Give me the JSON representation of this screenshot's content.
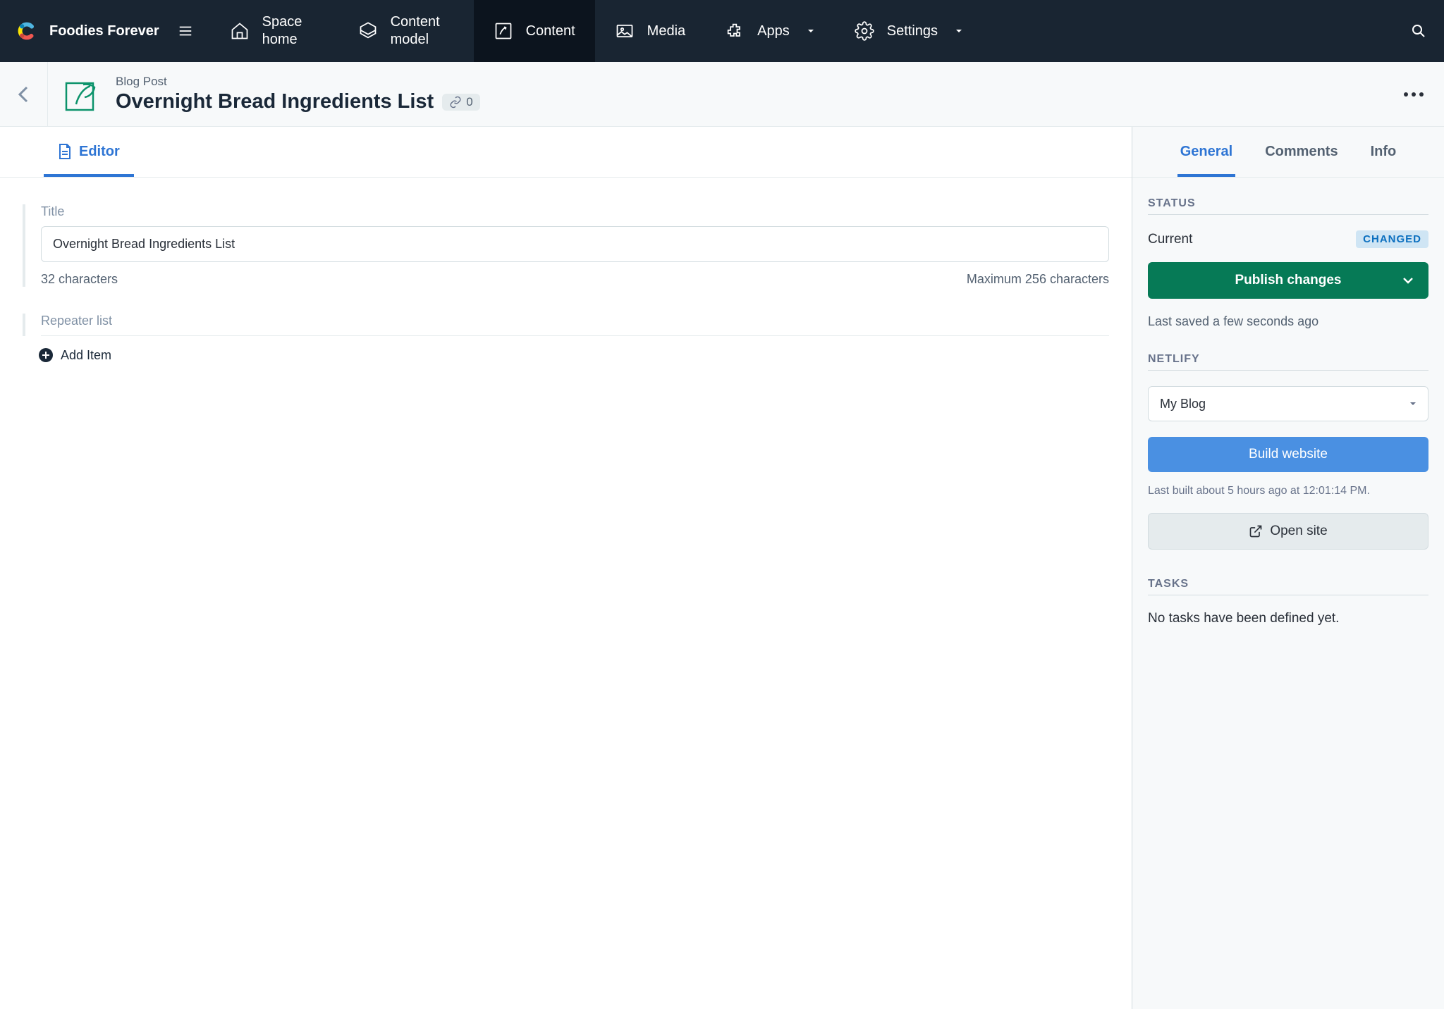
{
  "brand": {
    "name": "Foodies Forever"
  },
  "nav": {
    "space_home": "Space home",
    "content_model": "Content model",
    "content": "Content",
    "media": "Media",
    "apps": "Apps",
    "settings": "Settings"
  },
  "header": {
    "entry_type": "Blog Post",
    "entry_title": "Overnight Bread Ingredients List",
    "link_count": "0"
  },
  "editor": {
    "tab_label": "Editor",
    "title_label": "Title",
    "title_value": "Overnight Bread Ingredients List",
    "char_count": "32 characters",
    "char_max": "Maximum 256 characters",
    "repeater_label": "Repeater list",
    "add_item_label": "Add Item"
  },
  "side_tabs": {
    "general": "General",
    "comments": "Comments",
    "info": "Info"
  },
  "status": {
    "heading": "Status",
    "current_label": "Current",
    "badge": "CHANGED",
    "publish_label": "Publish changes",
    "last_saved": "Last saved a few seconds ago"
  },
  "netlify": {
    "heading": "Netlify",
    "site_selected": "My Blog",
    "build_label": "Build website",
    "last_built": "Last built about 5 hours ago at 12:01:14 PM.",
    "open_site_label": "Open site"
  },
  "tasks": {
    "heading": "Tasks",
    "empty_text": "No tasks have been defined yet."
  }
}
